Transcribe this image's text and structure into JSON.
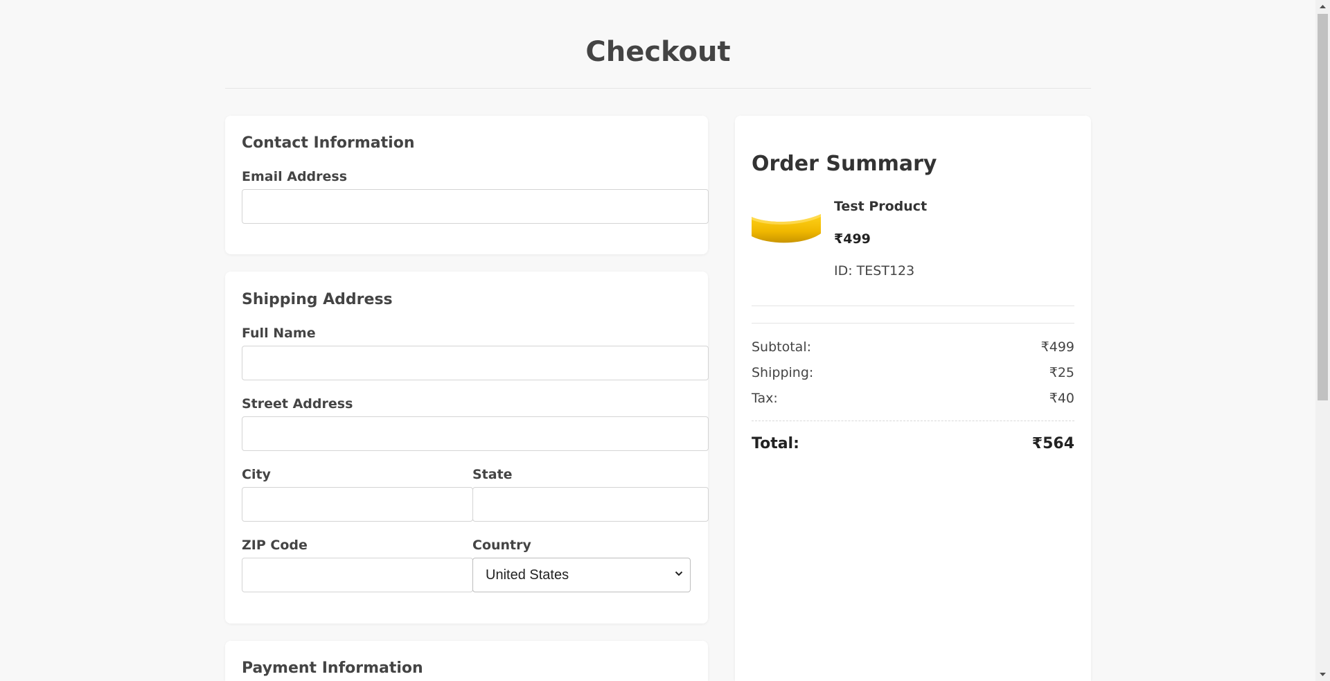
{
  "page": {
    "title": "Checkout"
  },
  "contact": {
    "heading": "Contact Information",
    "email_label": "Email Address",
    "email_value": ""
  },
  "shipping": {
    "heading": "Shipping Address",
    "full_name_label": "Full Name",
    "full_name_value": "",
    "street_label": "Street Address",
    "street_value": "",
    "city_label": "City",
    "city_value": "",
    "state_label": "State",
    "state_value": "",
    "zip_label": "ZIP Code",
    "zip_value": "",
    "country_label": "Country",
    "country_selected": "United States"
  },
  "payment": {
    "heading": "Payment Information"
  },
  "summary": {
    "heading": "Order Summary",
    "product": {
      "name": "Test Product",
      "price": "₹499",
      "id": "ID: TEST123",
      "image_icon": "banana-image"
    },
    "rows": [
      {
        "label": "Subtotal:",
        "value": "₹499"
      },
      {
        "label": "Shipping:",
        "value": "₹25"
      },
      {
        "label": "Tax:",
        "value": "₹40"
      }
    ],
    "total_label": "Total:",
    "total_value": "₹564"
  },
  "colors": {
    "background": "#f8f8f8",
    "card": "#ffffff",
    "text": "#333333",
    "banana": "#f2c200"
  }
}
